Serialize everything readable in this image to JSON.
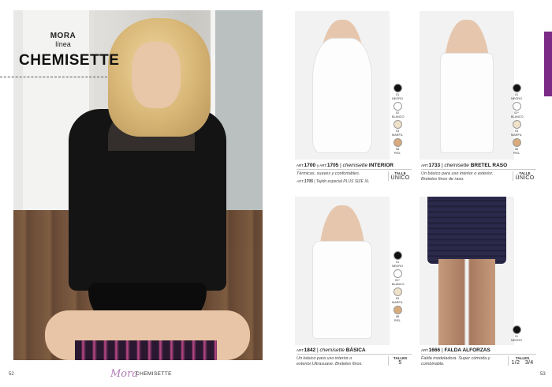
{
  "left_page": {
    "brand": "MORA",
    "line": "línea",
    "title": "CHEMISETTE",
    "page_number": "52",
    "footer_logo": "Mora",
    "footer_category": "CHEMISETTE"
  },
  "right_page": {
    "page_number": "53",
    "accent_color": "#7b2a86",
    "products": [
      {
        "art_prefix": "ART.",
        "art": "1700",
        "art_joiner": "y ART.",
        "art2": "1705",
        "kind": "chemisette",
        "name": "INTERIOR",
        "description": "Térmicas, suaves y confortables.",
        "extra_art_prefix": "ART.",
        "extra_art": "1705",
        "extra": "Tejido especial PLUS SIZE XL",
        "talle_label": "TALLE",
        "talle_value": "ÚNICO",
        "colors": [
          {
            "code": "01",
            "name": "NEGRO",
            "hex": "#111111"
          },
          {
            "code": "02",
            "name": "BLANCO",
            "hex": "#ffffff"
          },
          {
            "code": "03",
            "name": "MARFIL",
            "hex": "#efe2c9"
          },
          {
            "code": "08",
            "name": "PIEL",
            "hex": "#d9ab7c"
          }
        ]
      },
      {
        "art_prefix": "ART.",
        "art": "1733",
        "kind": "chemisette",
        "name": "BRETEL RASO",
        "description": "Un básico para uso interior o exterior. Breteles finos de raso.",
        "talle_label": "TALLE",
        "talle_value": "ÚNICO",
        "colors": [
          {
            "code": "01",
            "name": "NEGRO",
            "hex": "#111111"
          },
          {
            "code": "02*",
            "name": "BLANCO",
            "hex": "#ffffff"
          },
          {
            "code": "03",
            "name": "MARFIL",
            "hex": "#efe2c9"
          },
          {
            "code": "08",
            "name": "PIEL",
            "hex": "#d9ab7c"
          }
        ]
      },
      {
        "art_prefix": "ART.",
        "art": "1842",
        "kind": "chemisette",
        "name": "BÁSICA",
        "description": "Un básico para uso interior o exterior.Ultrasuave. Breteles finos.",
        "talle_label": "TALLES",
        "talle_value": "5",
        "colors": [
          {
            "code": "01",
            "name": "NEGRO",
            "hex": "#111111"
          },
          {
            "code": "02*",
            "name": "BLANCO",
            "hex": "#ffffff"
          },
          {
            "code": "03",
            "name": "MARFIL",
            "hex": "#efe2c9"
          },
          {
            "code": "08",
            "name": "PIEL",
            "hex": "#d9ab7c"
          }
        ]
      },
      {
        "art_prefix": "ART.",
        "art": "1666",
        "kind": "",
        "name": "FALDA ALFORZAS",
        "description": "Falda modeladora. Super cómoda y combinable.",
        "talle_label": "TALLES",
        "talle_value": "1/2   3/4",
        "colors": [
          {
            "code": "01",
            "name": "NEGRO",
            "hex": "#111111"
          }
        ]
      }
    ]
  }
}
